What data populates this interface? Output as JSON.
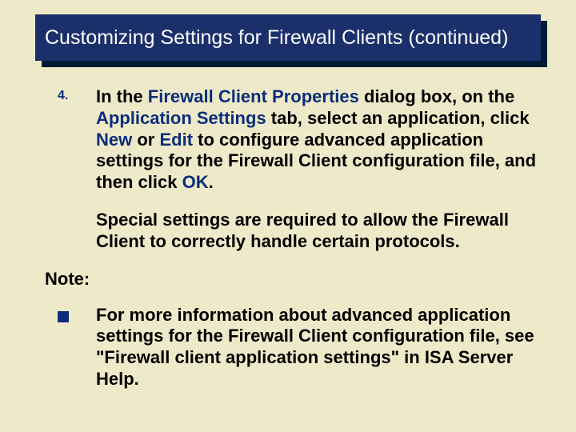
{
  "title": "Customizing Settings for Firewall Clients (continued)",
  "step": {
    "number": "4.",
    "parts": {
      "p1": "In the ",
      "b1": "Firewall Client Properties",
      "p2": " dialog box, on the ",
      "b2": "Application Settings",
      "p3": " tab, select an application, click ",
      "b3": "New",
      "p4": " or ",
      "b4": "Edit",
      "p5": " to configure advanced application settings for the Firewall Client configuration file, and then click ",
      "b5": "OK",
      "p6": "."
    }
  },
  "special": "Special settings are required to allow the Firewall Client to correctly handle certain protocols.",
  "noteLabel": "Note:",
  "noteBody": "For more information about advanced application settings for the Firewall Client configuration file, see \"Firewall client application settings\" in ISA Server Help."
}
